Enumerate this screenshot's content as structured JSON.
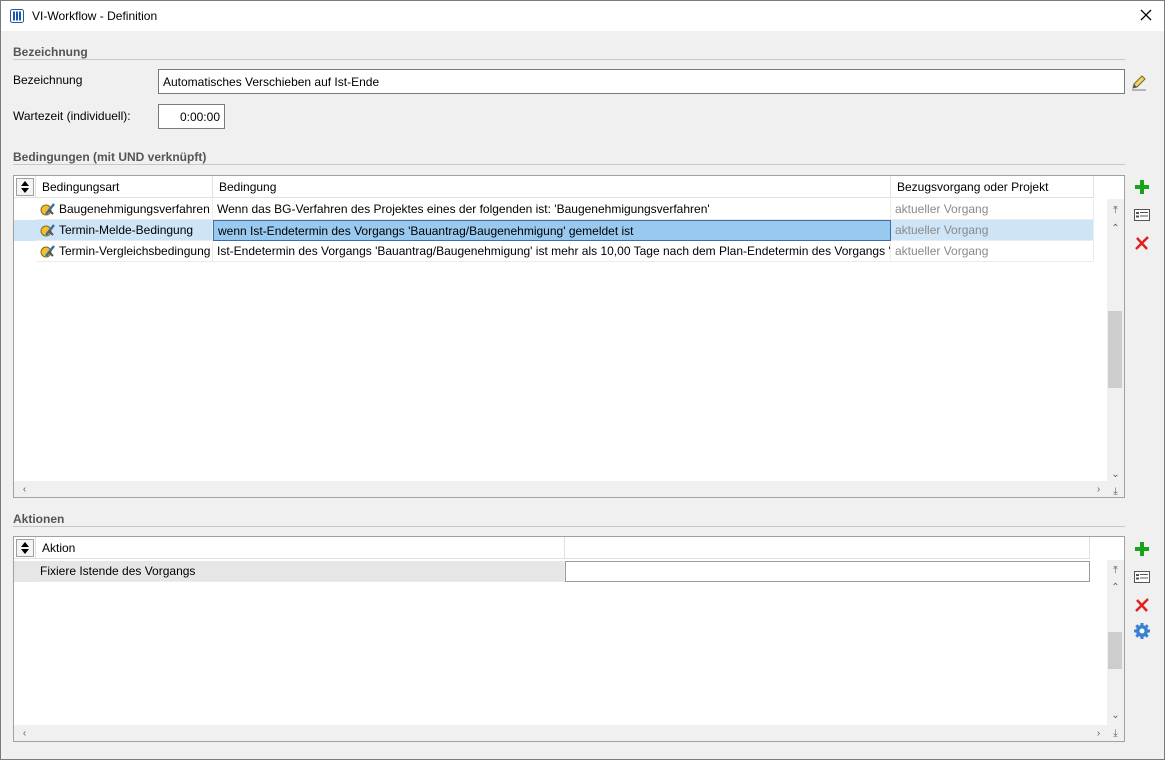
{
  "window": {
    "title": "VI-Workflow - Definition"
  },
  "bezeichnung_section": {
    "heading": "Bezeichnung",
    "name_label": "Bezeichnung",
    "name_value": "Automatisches Verschieben auf Ist-Ende",
    "wait_label": "Wartezeit (individuell):",
    "wait_value": "0:00:00"
  },
  "conditions": {
    "heading": "Bedingungen (mit UND verknüpft)",
    "columns": [
      "Bedingungsart",
      "Bedingung",
      "Bezugsvorgang oder Projekt"
    ],
    "rows": [
      {
        "type": "Baugenehmigungsverfahren",
        "condition": "Wenn das BG-Verfahren des Projektes eines der folgenden ist: 'Baugenehmigungsverfahren'",
        "reference": "aktueller Vorgang"
      },
      {
        "type": "Termin-Melde-Bedingung",
        "condition": "wenn Ist-Endetermin des Vorgangs 'Bauantrag/Baugenehmigung' gemeldet ist",
        "reference": "aktueller Vorgang"
      },
      {
        "type": "Termin-Vergleichsbedingung",
        "condition": "Ist-Endetermin des Vorgangs 'Bauantrag/Baugenehmigung' ist mehr als 10,00 Tage nach dem Plan-Endetermin des Vorgangs 'B",
        "reference": "aktueller Vorgang"
      }
    ],
    "selected_row": 1
  },
  "actions": {
    "heading": "Aktionen",
    "columns": [
      "Aktion"
    ],
    "rows": [
      {
        "action": "Fixiere Istende des Vorgangs",
        "value": ""
      }
    ]
  },
  "icons": {
    "app": "workflow-app-icon",
    "close": "close-icon",
    "edit": "pencil-icon",
    "add": "add-icon",
    "details": "details-icon",
    "delete": "delete-icon",
    "settings": "gear-icon"
  },
  "colors": {
    "accent": "#3a6ea5",
    "add": "#1aa31a",
    "delete": "#e02020",
    "selection": "#cde5f7"
  }
}
